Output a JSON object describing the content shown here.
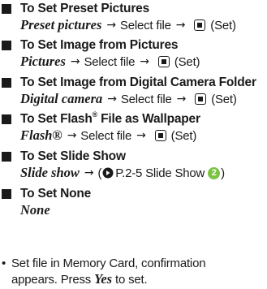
{
  "sections": [
    {
      "heading": "To Set Preset Pictures",
      "menu_item": "Preset pictures",
      "step1": "Select file",
      "step2": "(Set)"
    },
    {
      "heading": "To Set Image from Pictures",
      "menu_item": "Pictures",
      "step1": "Select file",
      "step2": "(Set)"
    },
    {
      "heading": "To Set Image from Digital Camera Folder",
      "menu_item": "Digital camera",
      "step1": "Select file",
      "step2": "(Set)"
    },
    {
      "heading_pre": "To Set Flash",
      "heading_sup": "®",
      "heading_post": " File as Wallpaper",
      "menu_item": "Flash®",
      "step1": "Select file",
      "step2": "(Set)"
    },
    {
      "heading": "To Set Slide Show",
      "menu_item": "Slide show",
      "ref_open": "(",
      "ref_text": "P.2-5 Slide Show",
      "ref_num": "2",
      "ref_close": ")"
    },
    {
      "heading": "To Set None",
      "menu_item": "None"
    }
  ],
  "note": {
    "bullet": "•",
    "line1": "Set file in Memory Card, confirmation",
    "line2_pre": "appears. Press ",
    "line2_em": "Yes",
    "line2_post": " to set."
  },
  "arrow_glyph": "→",
  "colors": {
    "text": "#1a1a1a",
    "step_number_circle": "#7cc243"
  },
  "icons": [
    "center-key-icon",
    "reference-arrow-icon",
    "step-number-icon"
  ]
}
